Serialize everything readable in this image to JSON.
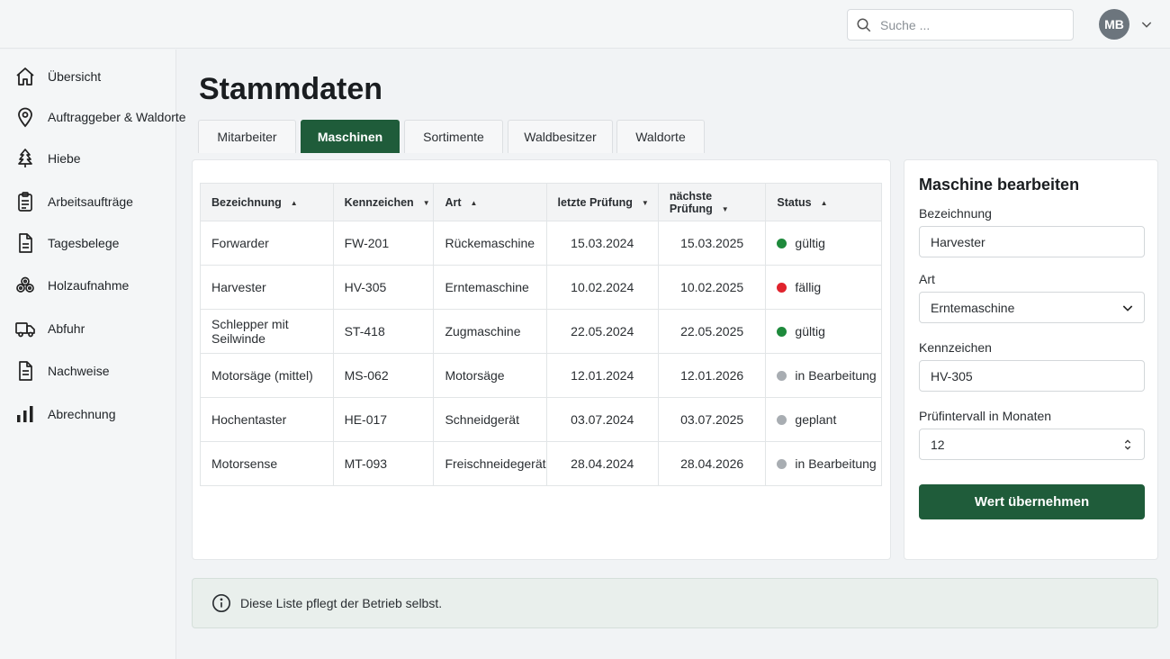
{
  "header": {
    "search_placeholder": "Suche ...",
    "avatar_initials": "MB"
  },
  "sidebar": {
    "items": [
      {
        "label": "Übersicht",
        "icon": "home-icon"
      },
      {
        "label": "Auftraggeber & Waldorte",
        "icon": "map-pin-icon"
      },
      {
        "label": "Hiebe",
        "icon": "tree-icon"
      },
      {
        "label": "Arbeitsaufträge",
        "icon": "clipboard-icon"
      },
      {
        "label": "Tagesbelege",
        "icon": "document-icon"
      },
      {
        "label": "Holzaufnahme",
        "icon": "logs-icon"
      },
      {
        "label": "Abfuhr",
        "icon": "truck-icon"
      },
      {
        "label": "Nachweise",
        "icon": "file-text-icon"
      },
      {
        "label": "Abrechnung",
        "icon": "bar-chart-icon"
      }
    ]
  },
  "page_title": "Stammdaten",
  "tabs": [
    {
      "label": "Mitarbeiter",
      "active": false
    },
    {
      "label": "Maschinen",
      "active": true
    },
    {
      "label": "Sortimente",
      "active": false
    },
    {
      "label": "Waldbesitzer",
      "active": false
    },
    {
      "label": "Waldorte",
      "active": false
    }
  ],
  "table": {
    "columns": [
      {
        "label": "Bezeichnung",
        "sort": "▲"
      },
      {
        "label": "Kennzeichen",
        "sort": "▼"
      },
      {
        "label": "Art",
        "sort": "▲"
      },
      {
        "label": "letzte Prüfung",
        "sort": "▼"
      },
      {
        "label": "nächste Prüfung",
        "sort": "▼"
      },
      {
        "label": "Status",
        "sort": "▲"
      }
    ],
    "rows": [
      {
        "bezeichnung": "Forwarder",
        "kennzeichen": "FW-201",
        "art": "Rückemaschine",
        "letzte": "15.03.2024",
        "naechste": "15.03.2025",
        "status": "gültig",
        "status_color": "#1e8a3c"
      },
      {
        "bezeichnung": "Harvester",
        "kennzeichen": "HV-305",
        "art": "Erntemaschine",
        "letzte": "10.02.2024",
        "naechste": "10.02.2025",
        "status": "fällig",
        "status_color": "#e0232d"
      },
      {
        "bezeichnung": "Schlepper mit Seilwinde",
        "kennzeichen": "ST-418",
        "art": "Zugmaschine",
        "letzte": "22.05.2024",
        "naechste": "22.05.2025",
        "status": "gültig",
        "status_color": "#1e8a3c"
      },
      {
        "bezeichnung": "Motorsäge (mittel)",
        "kennzeichen": "MS-062",
        "art": "Motorsäge",
        "letzte": "12.01.2024",
        "naechste": "12.01.2026",
        "status": "in Bearbeitung",
        "status_color": "#a8adb2"
      },
      {
        "bezeichnung": "Hochentaster",
        "kennzeichen": "HE-017",
        "art": "Schneidgerät",
        "letzte": "03.07.2024",
        "naechste": "03.07.2025",
        "status": "geplant",
        "status_color": "#a8adb2"
      },
      {
        "bezeichnung": "Motorsense",
        "kennzeichen": "MT-093",
        "art": "Freischneidegerät",
        "letzte": "28.04.2024",
        "naechste": "28.04.2026",
        "status": "in Bearbeitung",
        "status_color": "#a8adb2"
      }
    ]
  },
  "edit": {
    "title": "Maschine bearbeiten",
    "fields": {
      "bezeichnung_label": "Bezeichnung",
      "bezeichnung_value": "Harvester",
      "art_label": "Art",
      "art_value": "Erntemaschine",
      "kennzeichen_label": "Kennzeichen",
      "kennzeichen_value": "HV-305",
      "intervall_label": "Prüfintervall in Monaten",
      "intervall_value": "12"
    },
    "submit_label": "Wert übernehmen"
  },
  "info_text": "Diese Liste pflegt der Betrieb selbst.",
  "colors": {
    "accent": "#1f5c3a",
    "ok": "#1e8a3c",
    "due": "#e0232d",
    "neutral": "#a8adb2"
  }
}
